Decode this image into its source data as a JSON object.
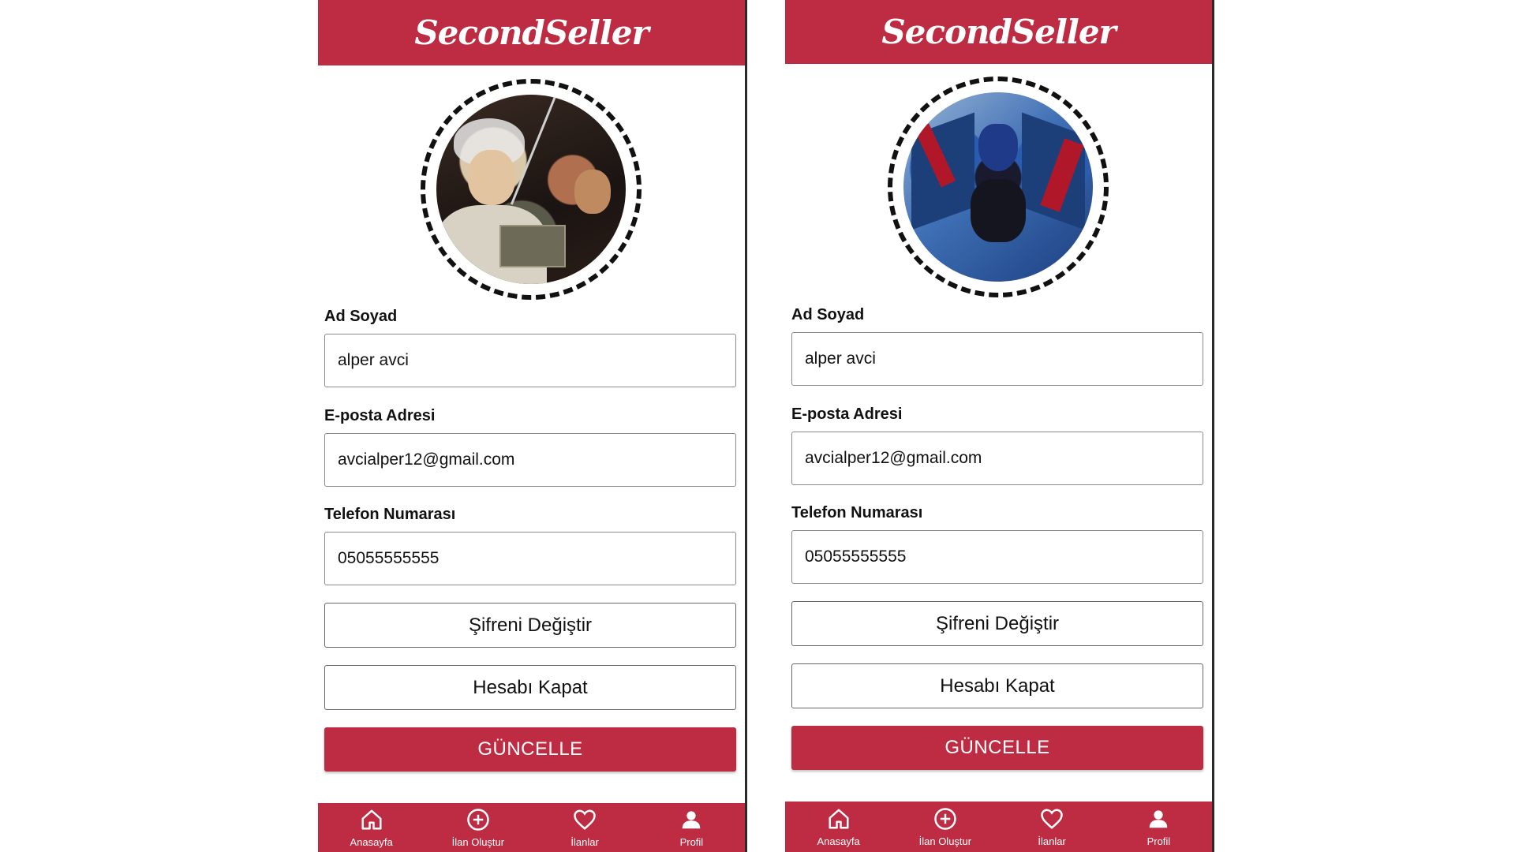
{
  "app": {
    "brand": "SecondSeller"
  },
  "form": {
    "name_label": "Ad Soyad",
    "name_value": "alper avci",
    "email_label": "E-posta Adresi",
    "email_value": "avcialper12@gmail.com",
    "phone_label": "Telefon Numarası",
    "phone_value": "05055555555",
    "change_password": "Şifreni Değiştir",
    "close_account": "Hesabı Kapat",
    "update": "GÜNCELLE"
  },
  "nav": {
    "home": "Anasayfa",
    "create": "İlan Oluştur",
    "listings": "İlanlar",
    "profile": "Profil"
  },
  "colors": {
    "brand": "#bd2c42",
    "text": "#111111",
    "border": "#8a8a8a"
  },
  "icons": [
    "home-icon",
    "plus-circle-icon",
    "heart-icon",
    "person-icon"
  ]
}
